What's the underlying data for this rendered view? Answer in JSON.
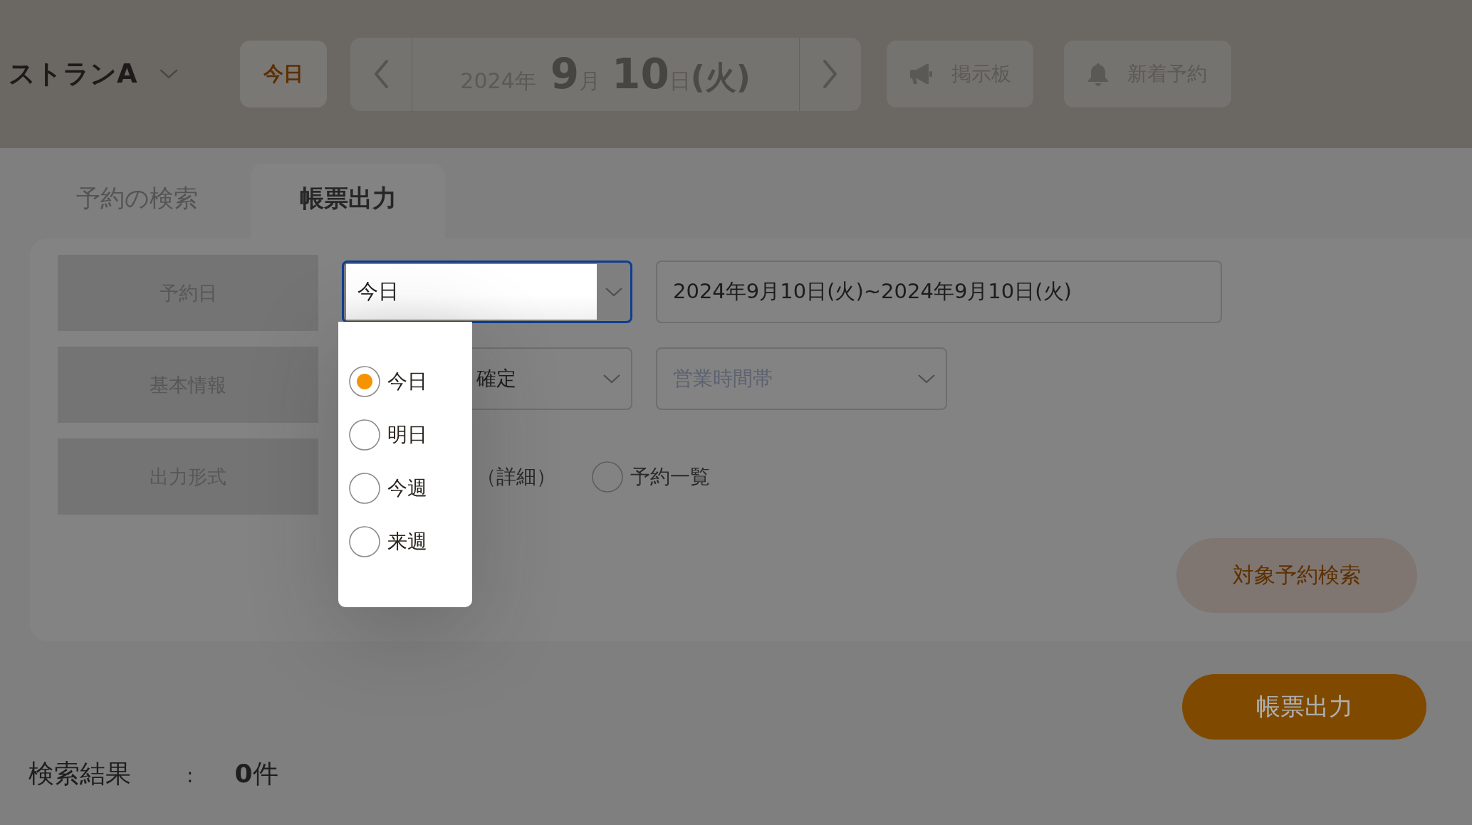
{
  "header": {
    "restaurant": {
      "name": "ストランA"
    },
    "today_button": {
      "label": "今日"
    },
    "date": {
      "year": "2024年",
      "month": "9",
      "month_unit": "月",
      "day": "10",
      "day_unit": "日",
      "weekday": "(火)"
    },
    "board_button": {
      "label": "掲示板"
    },
    "new_reservations_button": {
      "label": "新着予約"
    }
  },
  "tabs": [
    {
      "label": "予約の検索",
      "selected": false
    },
    {
      "label": "帳票出力",
      "selected": true
    }
  ],
  "form": {
    "rows": [
      {
        "kind": "date",
        "label": "予約日",
        "preset": {
          "value": "今日",
          "focused": true
        },
        "range": {
          "value": "2024年9月10日(火)~2024年9月10日(火)"
        }
      },
      {
        "kind": "selects",
        "label": "基本情報",
        "selects": [
          {
            "value": "確定"
          },
          {
            "placeholder": "営業時間帯"
          }
        ]
      },
      {
        "kind": "radios",
        "label": "出力形式",
        "partial_label": "（詳細）",
        "options": [
          {
            "label": "予約一覧",
            "selected": false
          }
        ]
      }
    ],
    "search_button": {
      "label": "対象予約検索"
    }
  },
  "preset_menu": {
    "options": [
      {
        "label": "今日",
        "selected": true
      },
      {
        "label": "明日",
        "selected": false
      },
      {
        "label": "今週",
        "selected": false
      },
      {
        "label": "来週",
        "selected": false
      }
    ]
  },
  "export_button": {
    "label": "帳票出力"
  },
  "result": {
    "label": "検索結果",
    "separator": ":",
    "count": "**0**件"
  }
}
